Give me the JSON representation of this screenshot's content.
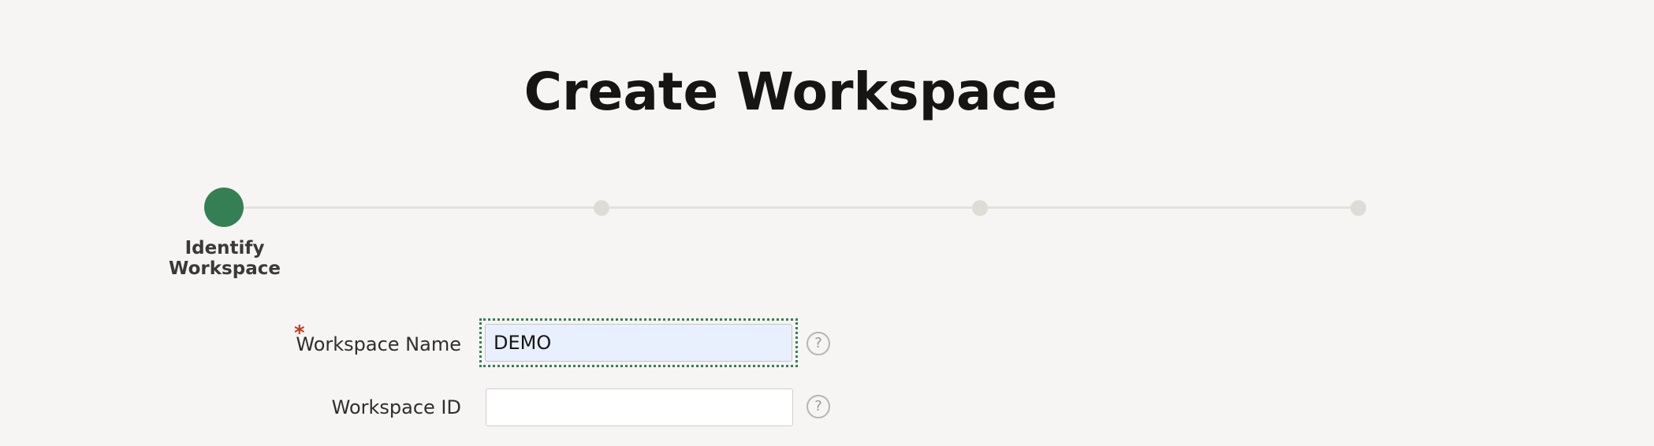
{
  "page": {
    "title": "Create Workspace"
  },
  "wizard": {
    "current_step_label": "Identify Workspace",
    "steps_total": 4,
    "active_step": 1
  },
  "form": {
    "workspace_name": {
      "label": "Workspace Name",
      "required_marker": "*",
      "value": "DEMO",
      "help_glyph": "?"
    },
    "workspace_id": {
      "label": "Workspace ID",
      "value": "",
      "help_glyph": "?"
    }
  },
  "colors": {
    "background": "#f6f5f3",
    "accent": "#357f55",
    "required": "#c23b22",
    "focused_input_bg": "#e8f0fd"
  },
  "icons": {
    "help": "help-icon"
  }
}
